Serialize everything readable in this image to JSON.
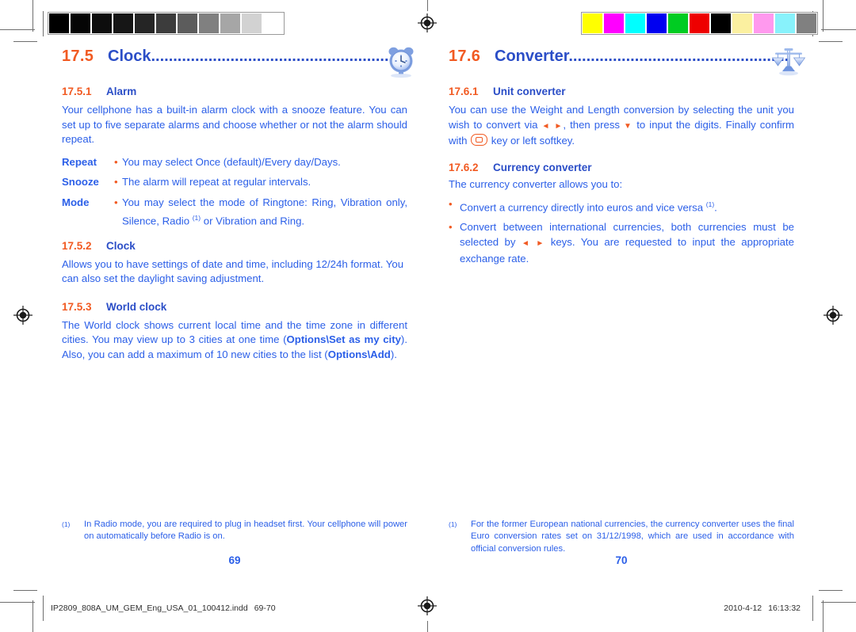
{
  "document": {
    "type": "printer-proof-spread",
    "slug_filename": "IP2809_808A_UM_GEM_Eng_USA_01_100412.indd",
    "slug_pages": "69-70",
    "slug_date": "2010-4-12",
    "slug_time": "16:13:32"
  },
  "colors": {
    "heading_number": "#f15a22",
    "heading_title": "#2b4ec7",
    "body_text": "#2b5fe8",
    "bullet": "#f15a22",
    "background": "#ffffff"
  },
  "calibration": {
    "gray_bar_label": "grayscale-calibration-bar",
    "gray_swatches": [
      "#000000",
      "#050505",
      "#0d0d0d",
      "#161616",
      "#252525",
      "#3c3c3c",
      "#5c5c5c",
      "#808080",
      "#a6a6a6",
      "#d2d2d2",
      "#ffffff"
    ],
    "color_bar_label": "color-calibration-bar",
    "color_swatches": [
      "#ffff00",
      "#ff00ff",
      "#00ffff",
      "#0000f0",
      "#00cc22",
      "#ee0000",
      "#000000",
      "#fbf0a0",
      "#ff99ee",
      "#88f2fb",
      "#808080"
    ]
  },
  "left_page": {
    "page_number": "69",
    "section": {
      "number": "17.5",
      "title": "Clock",
      "leader": ".............................................................",
      "icon": "alarm-clock-icon"
    },
    "sub1": {
      "number": "17.5.1",
      "title": "Alarm",
      "paragraph": "Your cellphone has a built-in alarm clock with a snooze feature. You can set up to five separate alarms and choose whether or not the alarm should repeat."
    },
    "definitions": [
      {
        "term": "Repeat",
        "bullet": "•",
        "text": "You may select Once (default)/Every day/Days."
      },
      {
        "term": "Snooze",
        "bullet": "•",
        "text": "The alarm will repeat at regular intervals."
      },
      {
        "term": "Mode",
        "bullet": "•",
        "text_pre": "You may select the mode of Ringtone: Ring, Vibration only, Silence, Radio ",
        "footnote_mark": "(1)",
        "text_post": " or Vibration and Ring."
      }
    ],
    "sub2": {
      "number": "17.5.2",
      "title": "Clock",
      "paragraph": "Allows you to have settings of date and time, including 12/24h format. You can also set the daylight saving adjustment."
    },
    "sub3": {
      "number": "17.5.3",
      "title": "World clock",
      "para_a": "The World clock shows current local time and the time zone in different cities. You may view up to 3 cities at one time (",
      "bold_a": "Options\\Set as my city",
      "para_b": "). Also, you can add a maximum of 10 new cities to the list (",
      "bold_b": "Options\\Add",
      "para_c": ")."
    },
    "footnote": {
      "mark": "(1)",
      "text": "In Radio mode, you are required to plug in headset first. Your cellphone will power on automatically before Radio is on."
    }
  },
  "right_page": {
    "page_number": "70",
    "section": {
      "number": "17.6",
      "title": "Converter",
      "leader": "..................................................",
      "icon": "balance-scales-icon"
    },
    "sub1": {
      "number": "17.6.1",
      "title": "Unit converter",
      "para_a": "You can use the Weight and Length conversion by selecting the unit you wish to convert via ",
      "glyph_lr": "◄ ►",
      "para_b": ", then press ",
      "glyph_down": "▼",
      "para_c": " to input the digits. Finally confirm with ",
      "glyph_key": "ok-key-icon",
      "para_d": " key or left softkey."
    },
    "sub2": {
      "number": "17.6.2",
      "title": "Currency converter",
      "lead": "The currency converter allows you to:",
      "bullets": [
        {
          "dot": "•",
          "text_pre": "Convert a currency directly into euros and vice versa ",
          "footnote_mark": "(1)",
          "text_post": "."
        },
        {
          "dot": "•",
          "text_pre": "Convert between international currencies, both currencies must be selected by ",
          "glyph_lr": "◄ ►",
          "text_post": " keys. You are requested to input the appropriate exchange rate."
        }
      ]
    },
    "footnote": {
      "mark": "(1)",
      "text": "For the former European national currencies, the currency converter uses the final Euro conversion rates set on 31/12/1998, which are used in accordance with official conversion rules."
    }
  }
}
